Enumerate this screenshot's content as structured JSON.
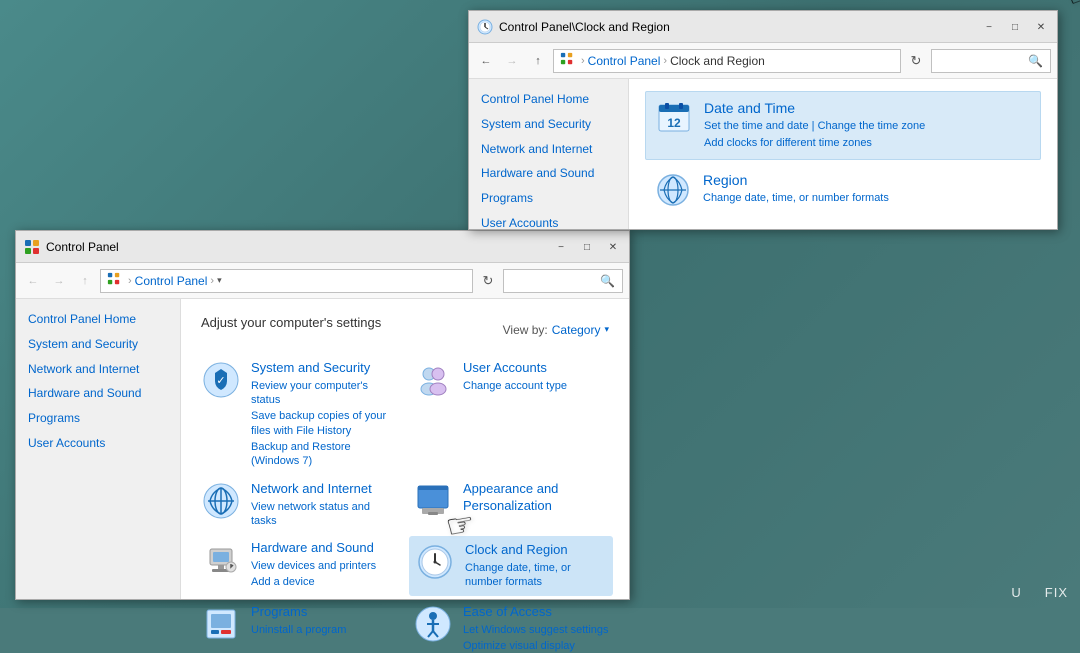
{
  "desktop": {
    "background": "#4a7a7a"
  },
  "window_cp": {
    "title": "Control Panel",
    "title_bar_icon": "🖥️",
    "address": {
      "path_home_icon": "⊞",
      "path_label": "Control Panel",
      "path_separator": "›",
      "search_placeholder": ""
    },
    "header": "Adjust your computer's settings",
    "view_by_label": "View by:",
    "view_by_value": "Category",
    "nav_items": [
      "Control Panel Home",
      "System and Security",
      "Network and Internet",
      "Hardware and Sound",
      "Programs",
      "User Accounts"
    ],
    "categories": [
      {
        "id": "system-security",
        "title": "System and Security",
        "subtitle1": "Review your computer's status",
        "subtitle2": "Save backup copies of your files with File History",
        "subtitle3": "Backup and Restore (Windows 7)"
      },
      {
        "id": "user-accounts",
        "title": "User Accounts",
        "subtitle1": "Change account type"
      },
      {
        "id": "network-internet",
        "title": "Network and Internet",
        "subtitle1": "View network status and tasks"
      },
      {
        "id": "appearance",
        "title": "Appearance and Personalization",
        "subtitle1": ""
      },
      {
        "id": "hardware-sound",
        "title": "Hardware and Sound",
        "subtitle1": "View devices and printers",
        "subtitle2": "Add a device"
      },
      {
        "id": "clock-region",
        "title": "Clock and Region",
        "subtitle1": "Change date, time, or number formats",
        "highlighted": true
      },
      {
        "id": "programs",
        "title": "Programs",
        "subtitle1": "Uninstall a program"
      },
      {
        "id": "ease-of-access",
        "title": "Ease of Access",
        "subtitle1": "Let Windows suggest settings",
        "subtitle2": "Optimize visual display"
      }
    ]
  },
  "window_cr": {
    "title": "Control Panel\\Clock and Region",
    "title_bar_icon": "🕐",
    "address": {
      "path_panel": "Control Panel",
      "path_separator": "›",
      "path_current": "Clock and Region",
      "search_placeholder": ""
    },
    "nav_items": [
      "Control Panel Home",
      "System and Security",
      "Network and Internet",
      "Hardware and Sound",
      "Programs",
      "User Accounts"
    ],
    "items": [
      {
        "id": "date-time",
        "title": "Date and Time",
        "link1": "Set the time and date",
        "link2": "Change the time zone",
        "link3": "Add clocks for different time zones",
        "highlighted": true
      },
      {
        "id": "region",
        "title": "Region",
        "link1": "Change date, time, or number formats"
      }
    ]
  },
  "watermark": "U       FIX"
}
